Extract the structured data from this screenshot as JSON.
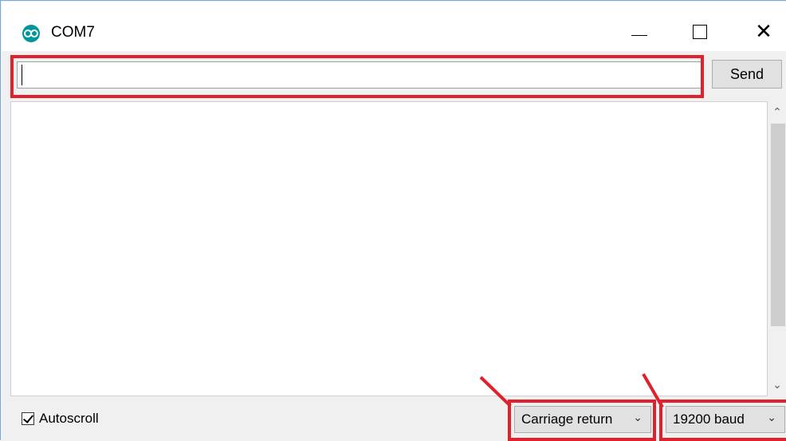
{
  "window": {
    "title": "COM7",
    "icon": "arduino-icon",
    "controls": {
      "minimize": "minimize-icon",
      "maximize": "maximize-icon",
      "close": "close-icon"
    }
  },
  "input": {
    "value": "",
    "send_label": "Send"
  },
  "output": {
    "text": ""
  },
  "status": {
    "autoscroll_label": "Autoscroll",
    "autoscroll_checked": true,
    "line_ending_selected": "Carriage return",
    "baud_selected": "19200 baud"
  },
  "annotation_color": "#e0202a"
}
